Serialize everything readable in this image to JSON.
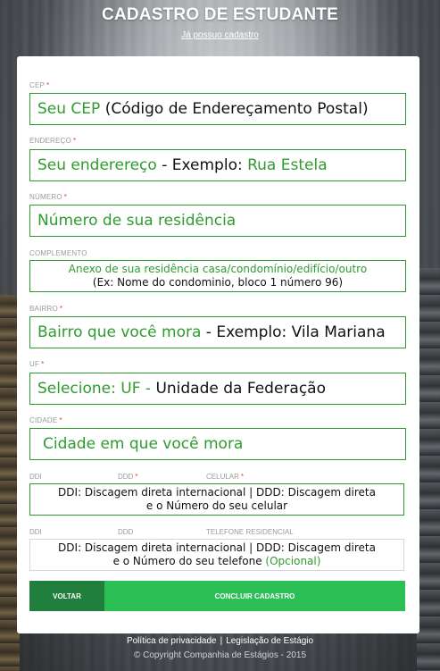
{
  "header": {
    "title": "CADASTRO DE ESTUDANTE",
    "already_link": "Já possuo cadastro"
  },
  "form": {
    "cep": {
      "label": "CEP",
      "required_mark": "*",
      "placeholder_a": "Seu CEP",
      "placeholder_b": "(Código de Endereçamento Postal)"
    },
    "endereco": {
      "label": "ENDEREÇO",
      "required_mark": "*",
      "placeholder_a": "Seu enderereço",
      "placeholder_b": "- Exemplo:",
      "placeholder_c": "Rua Estela"
    },
    "numero": {
      "label": "NÚMERO",
      "required_mark": "*",
      "placeholder": "Número de sua residência"
    },
    "complemento": {
      "label": "COMPLEMENTO",
      "placeholder_line1": "Anexo de sua residência casa/condomínio/edifício/outro",
      "placeholder_line2": "(Ex: Nome do condominio, bloco 1 número 96)"
    },
    "bairro": {
      "label": "BAIRRO",
      "required_mark": "*",
      "placeholder_a": "Bairro que você mora",
      "placeholder_b": "- Exemplo: Vila Mariana"
    },
    "uf": {
      "label": "UF",
      "required_mark": "*",
      "placeholder_a": "Selecione: UF -",
      "placeholder_b": "Unidade da Federação"
    },
    "cidade": {
      "label": "CIDADE",
      "required_mark": "*",
      "placeholder": "Cidade em que você mora"
    },
    "celular": {
      "ddi_label": "DDI",
      "ddd_label": "DDD",
      "ddd_required": "*",
      "num_label": "CELULAR",
      "num_required": "*",
      "placeholder_line1": "DDI: Discagem direta internacional | DDD: Discagem direta",
      "placeholder_line2": "e o Número do seu celular"
    },
    "telefone": {
      "ddi_label": "DDI",
      "ddd_label": "DDD",
      "num_label": "TELEFONE RESIDENCIAL",
      "placeholder_line1": "DDI: Discagem direta internacional | DDD: Discagem direta",
      "placeholder_line2a": "e o Número do seu telefone",
      "placeholder_line2b": "(Opcional)"
    },
    "buttons": {
      "back": "VOLTAR",
      "finish": "CONCLUIR CADASTRO"
    }
  },
  "footer": {
    "privacy": "Política de privacidade",
    "separator": "|",
    "legislation": "Legislação de Estágio",
    "copyright": "© Copyright Companhia de Estágios - 2015"
  },
  "colors": {
    "accent_green": "#2f9b2f",
    "button_dark": "#207f3d",
    "button_light": "#2bbf55",
    "required_red": "#e0452a"
  }
}
